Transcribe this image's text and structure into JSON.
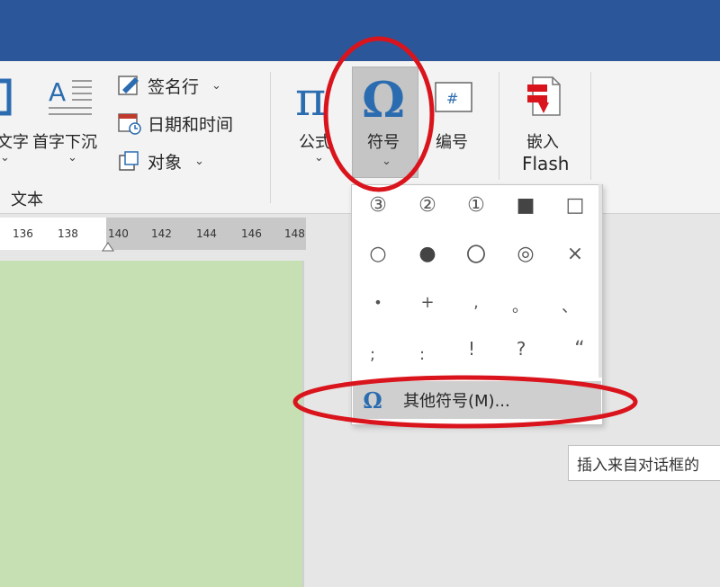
{
  "ribbon": {
    "text_box_partial": "文字",
    "drop_cap": "首字下沉",
    "signature_line": "签名行",
    "date_time": "日期和时间",
    "object": "对象",
    "group_text": "文本",
    "equation": "公式",
    "symbol": "符号",
    "numbering": "编号",
    "embed": "嵌入",
    "flash": "Flash",
    "chevron": "⌄"
  },
  "ruler": {
    "ticks": [
      "136",
      "138",
      "140",
      "142",
      "144",
      "146",
      "148"
    ]
  },
  "symbol_dropdown": {
    "rows": [
      [
        "③",
        "②",
        "①",
        "■",
        "□"
      ],
      [
        "○",
        "●",
        "〇",
        "◎",
        "×"
      ],
      [
        "•",
        "+",
        ",",
        "。",
        "、"
      ],
      [
        ";",
        ":",
        "!",
        "?",
        "“"
      ]
    ],
    "more_symbols": "其他符号(M)..."
  },
  "tooltip": {
    "text": "插入来自对话框的"
  },
  "colors": {
    "titlebar": "#2b579a",
    "page": "#c6e0b4",
    "highlight_circle": "#d9141c",
    "omega_blue": "#2b6cb0"
  }
}
